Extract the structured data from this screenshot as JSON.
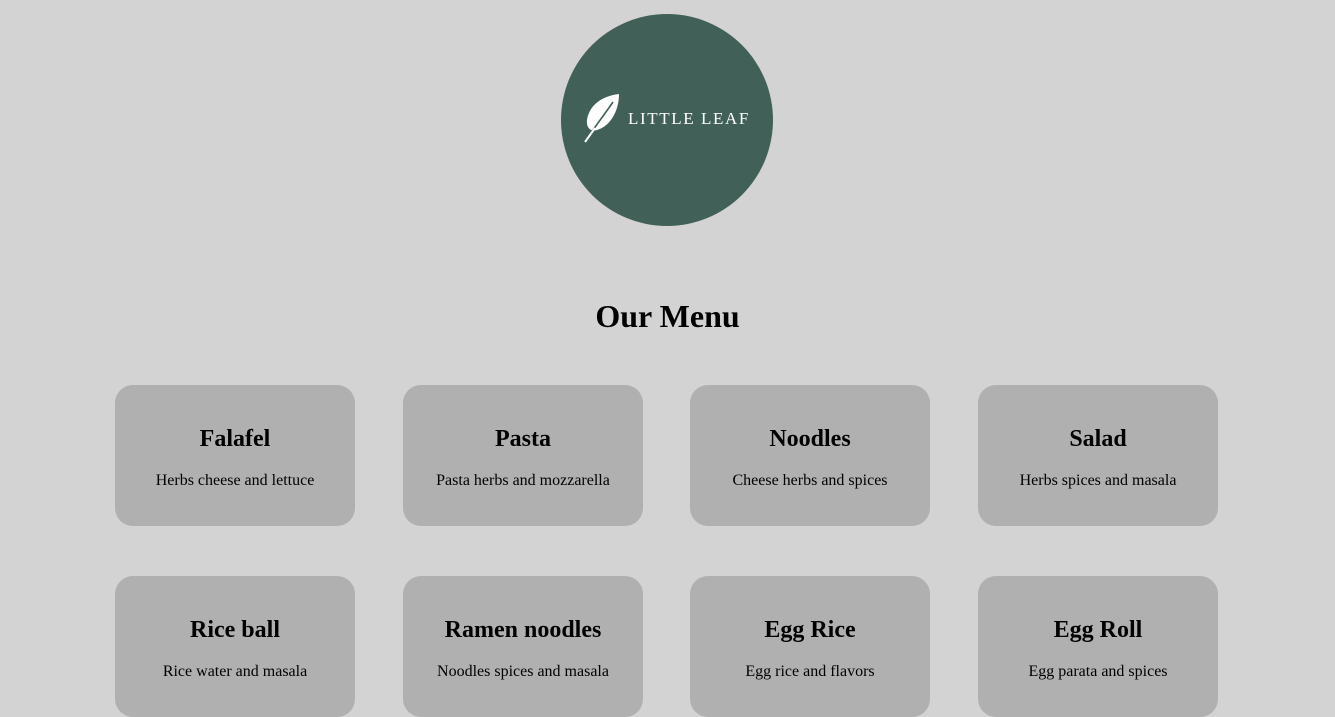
{
  "logo": {
    "text": "LITTLE LEAF",
    "icon": "leaf-icon",
    "background": "#416158"
  },
  "menu": {
    "title": "Our Menu",
    "items": [
      {
        "name": "Falafel",
        "description": "Herbs cheese and lettuce"
      },
      {
        "name": "Pasta",
        "description": "Pasta herbs and mozzarella"
      },
      {
        "name": "Noodles",
        "description": "Cheese herbs and spices"
      },
      {
        "name": "Salad",
        "description": "Herbs spices and masala"
      },
      {
        "name": "Rice ball",
        "description": "Rice water and masala"
      },
      {
        "name": "Ramen noodles",
        "description": "Noodles spices and masala"
      },
      {
        "name": "Egg Rice",
        "description": "Egg rice and flavors"
      },
      {
        "name": "Egg Roll",
        "description": "Egg parata and spices"
      }
    ]
  },
  "colors": {
    "page_background": "#d3d3d3",
    "card_background": "#b0b0b0"
  }
}
